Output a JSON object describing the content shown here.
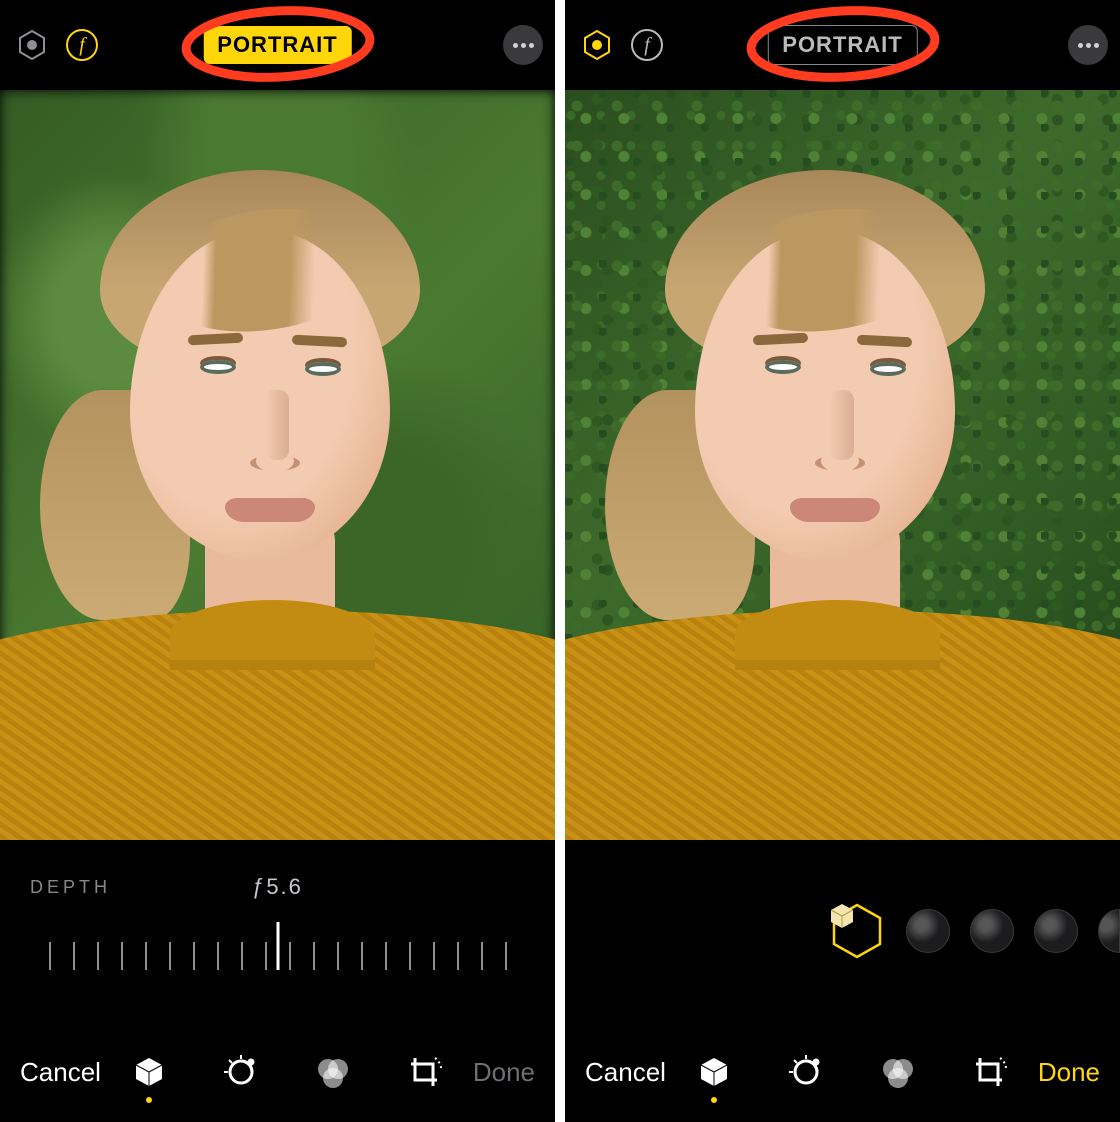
{
  "left": {
    "topbar": {
      "mode_badge": "PORTRAIT",
      "mode_active": true,
      "icons": {
        "lighting": "portrait-lighting-icon",
        "aperture": "aperture-f-icon",
        "more": "more-icon"
      }
    },
    "depth": {
      "label": "DEPTH",
      "value": "ƒ5.6"
    },
    "bottombar": {
      "cancel": "Cancel",
      "done": "Done",
      "done_enabled": false,
      "active_tool_index": 0,
      "tools": [
        "portrait-cube-icon",
        "adjust-dial-icon",
        "filters-circles-icon",
        "crop-rotate-icon"
      ]
    }
  },
  "right": {
    "topbar": {
      "mode_badge": "PORTRAIT",
      "mode_active": false,
      "icons": {
        "lighting": "portrait-lighting-icon",
        "aperture": "aperture-f-icon",
        "more": "more-icon"
      }
    },
    "lighting_carousel": {
      "selected_index": 0,
      "items": [
        "natural-light",
        "studio-light",
        "contour-light",
        "stage-light",
        "stage-mono"
      ]
    },
    "bottombar": {
      "cancel": "Cancel",
      "done": "Done",
      "done_enabled": true,
      "active_tool_index": 0,
      "tools": [
        "portrait-cube-icon",
        "adjust-dial-icon",
        "filters-circles-icon",
        "crop-rotate-icon"
      ]
    }
  },
  "colors": {
    "accent": "#ffd60a",
    "annotation": "#ff3b20"
  }
}
